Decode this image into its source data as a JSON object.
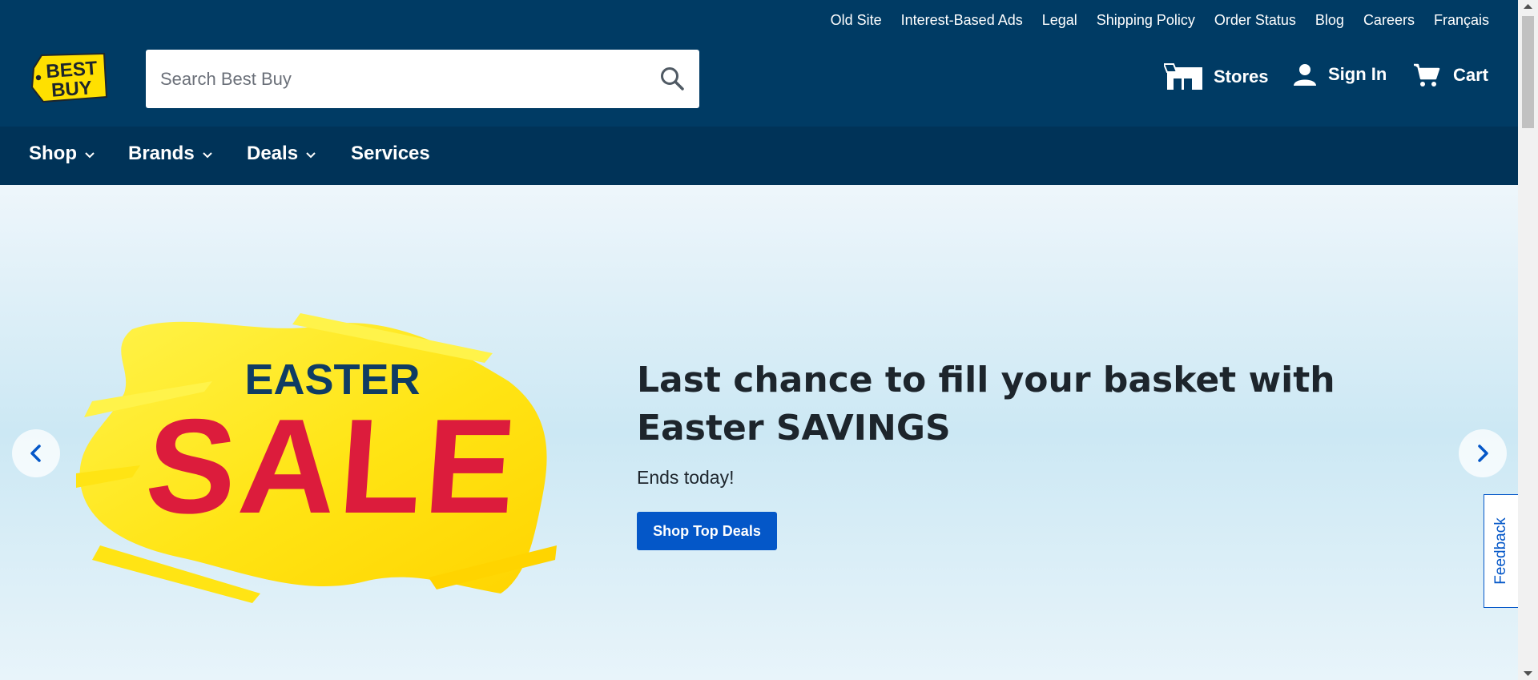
{
  "utility_links": [
    "Old Site",
    "Interest-Based Ads",
    "Legal",
    "Shipping Policy",
    "Order Status",
    "Blog",
    "Careers",
    "Français"
  ],
  "logo": {
    "line1": "BEST",
    "line2": "BUY"
  },
  "search": {
    "placeholder": "Search Best Buy",
    "value": ""
  },
  "header_actions": {
    "stores": "Stores",
    "sign_in": "Sign In",
    "cart": "Cart"
  },
  "nav": {
    "shop": "Shop",
    "brands": "Brands",
    "deals": "Deals",
    "services": "Services"
  },
  "hero": {
    "art_line1": "EASTER",
    "art_line2": "SALE",
    "title": "Last chance to fill your basket with Easter SAVINGS",
    "subtitle": "Ends today!",
    "cta": "Shop Top Deals"
  },
  "feedback": "Feedback",
  "colors": {
    "header_bg": "#003b64",
    "nav_bg": "#003358",
    "logo_yellow": "#ffe000",
    "sale_red": "#dc1c3c",
    "cta_blue": "#0457c8"
  }
}
